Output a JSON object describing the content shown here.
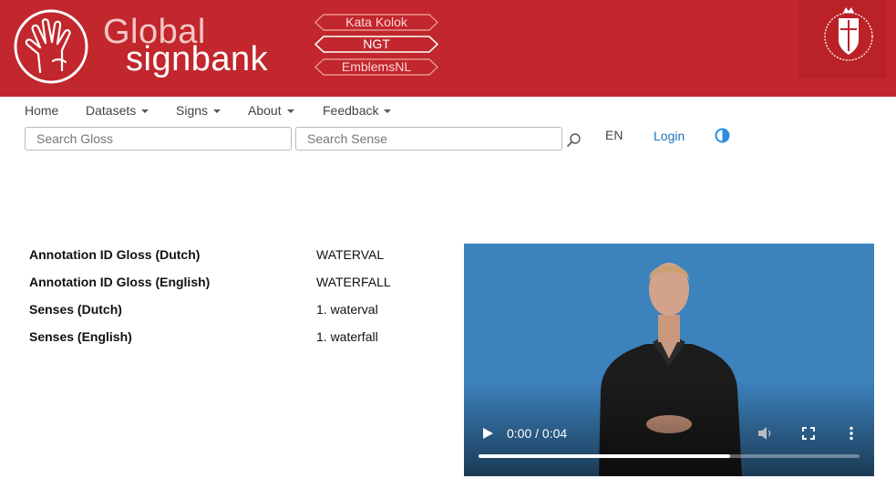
{
  "brand": {
    "line1": "Global",
    "line2": "signbank"
  },
  "datasets": [
    {
      "label": "Kata Kolok",
      "active": false
    },
    {
      "label": "NGT",
      "active": true
    },
    {
      "label": "EmblemsNL",
      "active": false
    }
  ],
  "nav": {
    "items": [
      "Home",
      "Datasets",
      "Signs",
      "About",
      "Feedback"
    ],
    "search_gloss_placeholder": "Search Gloss",
    "search_sense_placeholder": "Search Sense",
    "language": "EN",
    "login": "Login"
  },
  "gloss": {
    "rows": [
      {
        "label": "Annotation ID Gloss (Dutch)",
        "value": "WATERVAL"
      },
      {
        "label": "Annotation ID Gloss (English)",
        "value": "WATERFALL"
      },
      {
        "label": "Senses (Dutch)",
        "value": "1. waterval"
      },
      {
        "label": "Senses (English)",
        "value": "1. waterfall"
      }
    ]
  },
  "video": {
    "time_display": "0:00 / 0:04",
    "progress_fraction": 0.66
  },
  "colors": {
    "banner": "#c1272d",
    "link": "#1e73be",
    "video_bg": "#3c82bd"
  }
}
